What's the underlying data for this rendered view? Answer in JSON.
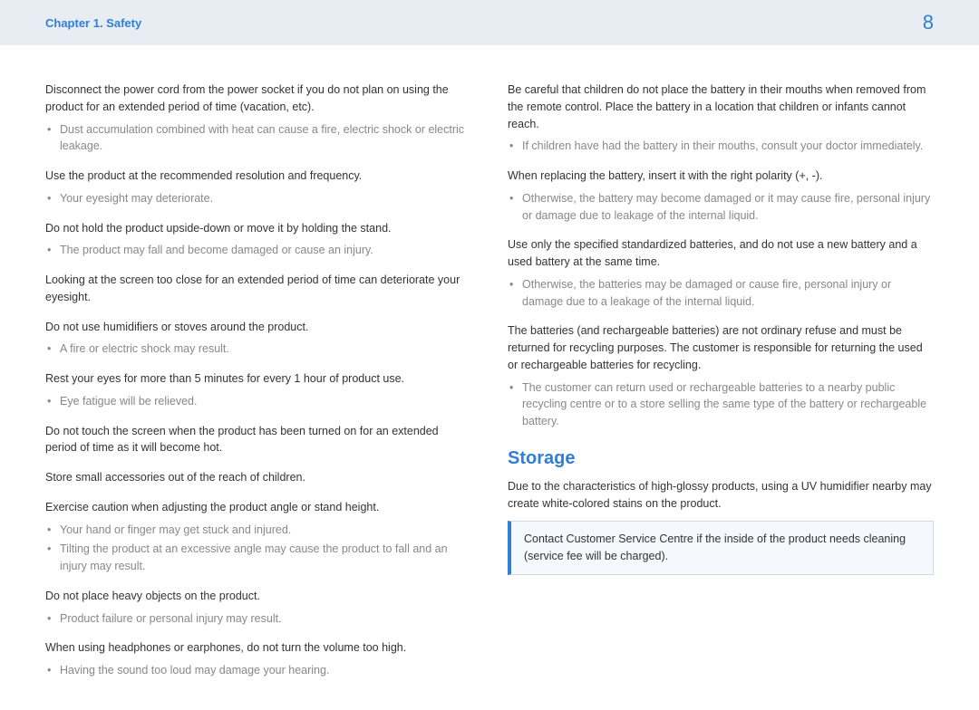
{
  "header": {
    "chapter": "Chapter 1. Safety",
    "page": "8"
  },
  "left": {
    "s1": {
      "text": "Disconnect the power cord from the power socket if you do not plan on using the product for an extended period of time (vacation, etc).",
      "b1": "Dust accumulation combined with heat can cause a fire, electric shock or electric leakage."
    },
    "s2": {
      "text": "Use the product at the recommended resolution and frequency.",
      "b1": "Your eyesight may deteriorate."
    },
    "s3": {
      "text": "Do not hold the product upside-down or move it by holding the stand.",
      "b1": "The product may fall and become damaged or cause an injury."
    },
    "s4": {
      "text": "Looking at the screen too close for an extended period of time can deteriorate your eyesight."
    },
    "s5": {
      "text": "Do not use humidifiers or stoves around the product.",
      "b1": "A fire or electric shock may result."
    },
    "s6": {
      "text": "Rest your eyes for more than 5 minutes for every 1 hour of product use.",
      "b1": "Eye fatigue will be relieved."
    },
    "s7": {
      "text": "Do not touch the screen when the product has been turned on for an extended period of time as it will become hot."
    },
    "s8": {
      "text": "Store small accessories out of the reach of children."
    },
    "s9": {
      "text": "Exercise caution when adjusting the product angle or stand height.",
      "b1": "Your hand or finger may get stuck and injured.",
      "b2": "Tilting the product at an excessive angle may cause the product to fall and an injury may result."
    },
    "s10": {
      "text": "Do not place heavy objects on the product.",
      "b1": "Product failure or personal injury may result."
    },
    "s11": {
      "text": "When using headphones or earphones, do not turn the volume too high.",
      "b1": "Having the sound too loud may damage your hearing."
    }
  },
  "right": {
    "s1": {
      "text": "Be careful that children do not place the battery in their mouths when removed from the remote control. Place the battery in a location that children or infants cannot reach.",
      "b1": "If children have had the battery in their mouths, consult your doctor immediately."
    },
    "s2": {
      "text": "When replacing the battery, insert it with the right polarity (+, -).",
      "b1": "Otherwise, the battery may become damaged or it may cause fire, personal injury or damage due to leakage of the internal liquid."
    },
    "s3": {
      "text": "Use only the specified standardized batteries, and do not use a new battery and a used battery at the same time.",
      "b1": "Otherwise, the batteries may be damaged or cause fire, personal injury or damage due to a leakage of the internal liquid."
    },
    "s4": {
      "text": "The batteries (and rechargeable batteries) are not ordinary refuse and must be returned for recycling purposes. The customer is responsible for returning the used or rechargeable batteries for recycling.",
      "b1": "The customer can return used or rechargeable batteries to a nearby public recycling centre or to a store selling the same type of the battery or rechargeable battery."
    },
    "storage": {
      "heading": "Storage",
      "text": "Due to the characteristics of high-glossy products, using a UV humidifier nearby may create white-colored stains on the product.",
      "note": "Contact Customer Service Centre if the inside of the product needs cleaning (service fee will be charged)."
    }
  }
}
